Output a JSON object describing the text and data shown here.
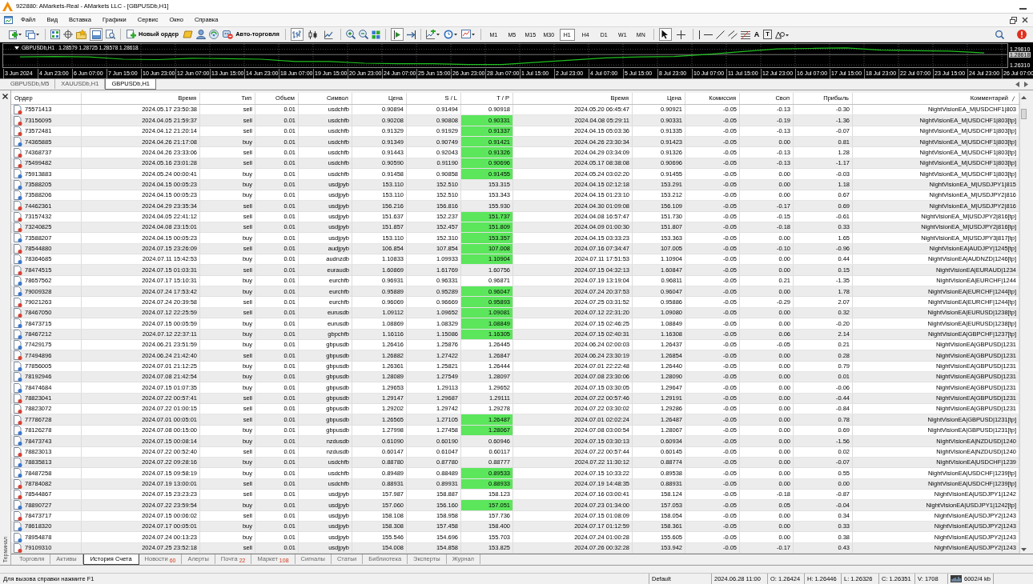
{
  "window": {
    "title": "922880: AMarkets-Real - AMarkets LLC - [GBPUSDb,H1]"
  },
  "menu": [
    "Файл",
    "Вид",
    "Вставка",
    "Графики",
    "Сервис",
    "Окно",
    "Справка"
  ],
  "toolbar": {
    "terminal_toggle": {
      "pressed": true
    },
    "new_order": "Новый ордер",
    "autotrading": "Авто-торговля",
    "chart_types": [
      {
        "selected": true
      },
      {
        "selected": false
      },
      {
        "selected": false
      }
    ],
    "chart_shift": {
      "pressed": true
    },
    "timeframes": [
      {
        "label": "M1",
        "selected": false
      },
      {
        "label": "M5",
        "selected": false
      },
      {
        "label": "M15",
        "selected": false
      },
      {
        "label": "M30",
        "selected": false
      },
      {
        "label": "H1",
        "selected": true
      },
      {
        "label": "H4",
        "selected": false
      },
      {
        "label": "D1",
        "selected": false
      },
      {
        "label": "W1",
        "selected": false
      },
      {
        "label": "MN",
        "selected": false
      }
    ],
    "cursor_tools": [
      {
        "selected": true
      },
      {
        "selected": false
      }
    ],
    "text_tools": [
      "A",
      "T"
    ]
  },
  "chart": {
    "symbol": "GBPUSDb,H1",
    "quotes": "1.28579 1.28725 1.28578 1.28618",
    "chart_data": [
      {
        "type": "line",
        "categories": [
          "3 Jun 2024",
          "4 Jun 23:00",
          "6 Jun 07:00",
          "7 Jun 15:00",
          "10 Jun 23:00",
          "12 Jun 07:00",
          "13 Jun 15:00",
          "14 Jun 23:00",
          "18 Jun 07:00",
          "19 Jun 15:00",
          "20 Jun 23:00",
          "24 Jun 07:00",
          "25 Jun 15:00",
          "26 Jun 23:00",
          "28 Jun 07:00",
          "1 Jul 15:00",
          "2 Jul 23:00",
          "4 Jul 07:00",
          "5 Jul 15:00",
          "8 Jul 23:00",
          "10 Jul 07:00",
          "11 Jul 15:00",
          "12 Jul 23:00",
          "16 Jul 07:00",
          "17 Jul 15:00",
          "18 Jul 23:00",
          "22 Jul 07:00",
          "23 Jul 15:00",
          "24 Jul 23:00",
          "26 Jul 07:00"
        ],
        "values": [
          1.281,
          1.282,
          1.281,
          1.276,
          1.275,
          1.278,
          1.277,
          1.276,
          1.271,
          1.271,
          1.267,
          1.266,
          1.266,
          1.264,
          1.264,
          1.269,
          1.274,
          1.279,
          1.281,
          1.282,
          1.287,
          1.293,
          1.299,
          1.3,
          1.301,
          1.296,
          1.295,
          1.294,
          1.29,
          null
        ],
        "color": "#1fc01f",
        "ylim": [
          1.2581,
          1.3098
        ],
        "yticks": [
          {
            "value": 1.2981,
            "label": "1.29810"
          },
          {
            "value": 1.2631,
            "label": "1.26310"
          }
        ],
        "ref_lines": [
          {
            "axis": "y",
            "value": 1.28618,
            "label": "1.28618",
            "color": "#c8c8c8",
            "line_style": "solid"
          }
        ],
        "grid": true
      }
    ]
  },
  "chart_tabs": [
    {
      "label": "GBPUSDb,M5",
      "selected": false
    },
    {
      "label": "XAUUSDb,H1",
      "selected": false
    },
    {
      "label": "GBPUSDb,H1",
      "selected": true
    }
  ],
  "terminal": {
    "side_label": "Терминал",
    "columns": [
      {
        "label": "Ордер",
        "sorted": false
      },
      {
        "label": "Время",
        "sorted": false
      },
      {
        "label": "Тип",
        "sorted": false
      },
      {
        "label": "Объем",
        "sorted": false
      },
      {
        "label": "Символ",
        "sorted": false
      },
      {
        "label": "Цена",
        "sorted": false
      },
      {
        "label": "S / L",
        "sorted": false
      },
      {
        "label": "T / P",
        "sorted": false
      },
      {
        "label": "Время",
        "sorted": false
      },
      {
        "label": "Цена",
        "sorted": false
      },
      {
        "label": "Комиссия",
        "sorted": false
      },
      {
        "label": "Своп",
        "sorted": false
      },
      {
        "label": "Прибыль",
        "sorted": false
      },
      {
        "label": "Комментарий",
        "sorted": true
      }
    ],
    "rows": [
      {
        "kind": "sell",
        "tp_hit": false,
        "cells": [
          "75571413",
          "2024.05.17 23:50:38",
          "sell",
          "0.01",
          "usdchfb",
          "0.90894",
          "0.91494",
          "0.90918",
          "2024.05.20 06:45:47",
          "0.90921",
          "-0.05",
          "-0.13",
          "-0.30",
          "NightVisionEA_M|USDCHF1|803"
        ]
      },
      {
        "kind": "sell",
        "tp_hit": true,
        "cells": [
          "73156095",
          "2024.04.05 21:59:37",
          "sell",
          "0.01",
          "usdchfb",
          "0.90208",
          "0.90808",
          "0.90331",
          "2024.04.08 05:29:11",
          "0.90331",
          "-0.05",
          "-0.19",
          "-1.36",
          "NightVisionEA_M|USDCHF1|803[tp]"
        ]
      },
      {
        "kind": "sell",
        "tp_hit": true,
        "cells": [
          "73572481",
          "2024.04.12 21:20:14",
          "sell",
          "0.01",
          "usdchfb",
          "0.91329",
          "0.91929",
          "0.91337",
          "2024.04.15 05:03:36",
          "0.91335",
          "-0.05",
          "-0.13",
          "-0.07",
          "NightVisionEA_M|USDCHF1|803[tp]"
        ]
      },
      {
        "kind": "buy",
        "tp_hit": true,
        "cells": [
          "74365885",
          "2024.04.26 21:17:08",
          "buy",
          "0.01",
          "usdchfb",
          "0.91349",
          "0.90749",
          "0.91421",
          "2024.04.26 23:30:34",
          "0.91423",
          "-0.05",
          "0.00",
          "0.81",
          "NightVisionEA_M|USDCHF1|803[tp]"
        ]
      },
      {
        "kind": "sell",
        "tp_hit": true,
        "cells": [
          "74368737",
          "2024.04.26 23:33:06",
          "sell",
          "0.01",
          "usdchfb",
          "0.91443",
          "0.92043",
          "0.91326",
          "2024.04.29 03:34:09",
          "0.91326",
          "-0.05",
          "-0.13",
          "1.28",
          "NightVisionEA_M|USDCHF1|803[tp]"
        ]
      },
      {
        "kind": "sell",
        "tp_hit": true,
        "cells": [
          "75499482",
          "2024.05.16 23:01:28",
          "sell",
          "0.01",
          "usdchfb",
          "0.90590",
          "0.91190",
          "0.90696",
          "2024.05.17 08:38:08",
          "0.90696",
          "-0.05",
          "-0.13",
          "-1.17",
          "NightVisionEA_M|USDCHF1|803[tp]"
        ]
      },
      {
        "kind": "buy",
        "tp_hit": true,
        "cells": [
          "75913883",
          "2024.05.24 00:00:41",
          "buy",
          "0.01",
          "usdchfb",
          "0.91458",
          "0.90858",
          "0.91455",
          "2024.05.24 03:02:20",
          "0.91455",
          "-0.05",
          "0.00",
          "-0.03",
          "NightVisionEA_M|USDCHF1|803[tp]"
        ]
      },
      {
        "kind": "buy",
        "tp_hit": false,
        "cells": [
          "73588205",
          "2024.04.15 00:05:23",
          "buy",
          "0.01",
          "usdjpyb",
          "153.110",
          "152.510",
          "153.315",
          "2024.04.15 02:12:18",
          "153.291",
          "-0.05",
          "0.00",
          "1.18",
          "NightVisionEA_M|USDJPY1|815"
        ]
      },
      {
        "kind": "buy",
        "tp_hit": false,
        "cells": [
          "73588206",
          "2024.04.15 00:05:23",
          "buy",
          "0.01",
          "usdjpyb",
          "153.110",
          "152.510",
          "153.343",
          "2024.04.15 01:23:10",
          "153.212",
          "-0.05",
          "0.00",
          "0.67",
          "NightVisionEA_M|USDJPY2|816"
        ]
      },
      {
        "kind": "sell",
        "tp_hit": false,
        "cells": [
          "74462361",
          "2024.04.29 23:35:34",
          "sell",
          "0.01",
          "usdjpyb",
          "156.216",
          "156.816",
          "155.930",
          "2024.04.30 01:09:08",
          "156.109",
          "-0.05",
          "-0.17",
          "0.69",
          "NightVisionEA_M|USDJPY2|816"
        ]
      },
      {
        "kind": "sell",
        "tp_hit": true,
        "cells": [
          "73157432",
          "2024.04.05 22:41:12",
          "sell",
          "0.01",
          "usdjpyb",
          "151.637",
          "152.237",
          "151.737",
          "2024.04.08 16:57:47",
          "151.730",
          "-0.05",
          "-0.15",
          "-0.61",
          "NightVisionEA_M|USDJPY2|816[tp]"
        ]
      },
      {
        "kind": "sell",
        "tp_hit": true,
        "cells": [
          "73240825",
          "2024.04.08 23:15:01",
          "sell",
          "0.01",
          "usdjpyb",
          "151.857",
          "152.457",
          "151.809",
          "2024.04.09 01:00:30",
          "151.807",
          "-0.05",
          "-0.18",
          "0.33",
          "NightVisionEA_M|USDJPY2|816[tp]"
        ]
      },
      {
        "kind": "buy",
        "tp_hit": true,
        "cells": [
          "73588207",
          "2024.04.15 00:05:23",
          "buy",
          "0.01",
          "usdjpyb",
          "153.110",
          "152.310",
          "153.357",
          "2024.04.15 03:33:23",
          "153.363",
          "-0.05",
          "0.00",
          "1.65",
          "NightVisionEA_M|USDJPY3|817[tp]"
        ]
      },
      {
        "kind": "sell",
        "tp_hit": true,
        "cells": [
          "78544880",
          "2024.07.15 23:26:09",
          "sell",
          "0.01",
          "audjpyb",
          "106.854",
          "107.854",
          "107.008",
          "2024.07.16 07:34:47",
          "107.005",
          "-0.05",
          "-0.10",
          "-0.96",
          "NightVisionEA|AUDJPY|1245[tp]"
        ]
      },
      {
        "kind": "buy",
        "tp_hit": true,
        "cells": [
          "78364685",
          "2024.07.11 15:42:53",
          "buy",
          "0.01",
          "audnzdb",
          "1.10833",
          "1.09933",
          "1.10904",
          "2024.07.11 17:51:53",
          "1.10904",
          "-0.05",
          "0.00",
          "0.44",
          "NightVisionEA|AUDNZD|1246[tp]"
        ]
      },
      {
        "kind": "sell",
        "tp_hit": false,
        "cells": [
          "78474515",
          "2024.07.15 01:03:31",
          "sell",
          "0.01",
          "euraudb",
          "1.60869",
          "1.61769",
          "1.60756",
          "2024.07.15 04:32:13",
          "1.60847",
          "-0.05",
          "0.00",
          "0.15",
          "NightVisionEA|EURAUD|1234"
        ]
      },
      {
        "kind": "buy",
        "tp_hit": false,
        "cells": [
          "78657562",
          "2024.07.17 15:10:31",
          "buy",
          "0.01",
          "eurchfb",
          "0.96931",
          "0.96331",
          "0.96871",
          "2024.07.19 13:19:04",
          "0.96811",
          "-0.05",
          "0.21",
          "-1.35",
          "NightVisionEA|EURCHF|1244"
        ]
      },
      {
        "kind": "buy",
        "tp_hit": true,
        "cells": [
          "79009328",
          "2024.07.24 17:53:42",
          "buy",
          "0.01",
          "eurchfb",
          "0.95889",
          "0.95289",
          "0.96047",
          "2024.07.24 20:37:53",
          "0.96047",
          "-0.05",
          "0.00",
          "1.78",
          "NightVisionEA|EURCHF|1244[tp]"
        ]
      },
      {
        "kind": "sell",
        "tp_hit": true,
        "cells": [
          "79021263",
          "2024.07.24 20:39:58",
          "sell",
          "0.01",
          "eurchfb",
          "0.96069",
          "0.96669",
          "0.95893",
          "2024.07.25 03:31:52",
          "0.95886",
          "-0.05",
          "-0.29",
          "2.07",
          "NightVisionEA|EURCHF|1244[tp]"
        ]
      },
      {
        "kind": "sell",
        "tp_hit": true,
        "cells": [
          "78467050",
          "2024.07.12 22:25:59",
          "sell",
          "0.01",
          "eurusdb",
          "1.09112",
          "1.09652",
          "1.09081",
          "2024.07.12 22:31:20",
          "1.09080",
          "-0.05",
          "0.00",
          "0.32",
          "NightVisionEA|EURUSD|1238[tp]"
        ]
      },
      {
        "kind": "buy",
        "tp_hit": true,
        "cells": [
          "78473715",
          "2024.07.15 00:05:59",
          "buy",
          "0.01",
          "eurusdb",
          "1.08869",
          "1.08329",
          "1.08849",
          "2024.07.15 02:46:25",
          "1.08849",
          "-0.05",
          "0.00",
          "-0.20",
          "NightVisionEA|EURUSD|1238[tp]"
        ]
      },
      {
        "kind": "buy",
        "tp_hit": true,
        "cells": [
          "78467212",
          "2024.07.12 22:37:11",
          "buy",
          "0.01",
          "gbpchfb",
          "1.16116",
          "1.15086",
          "1.16305",
          "2024.07.15 02:40:31",
          "1.16308",
          "-0.05",
          "0.06",
          "2.14",
          "NightVisionEA|GBPCHF|1237[tp]"
        ]
      },
      {
        "kind": "buy",
        "tp_hit": false,
        "cells": [
          "77429175",
          "2024.06.21 23:51:59",
          "buy",
          "0.01",
          "gbpusdb",
          "1.26416",
          "1.25876",
          "1.26445",
          "2024.06.24 02:00:03",
          "1.26437",
          "-0.05",
          "-0.05",
          "0.21",
          "NightVisionEA|GBPUSD|1231"
        ]
      },
      {
        "kind": "sell",
        "tp_hit": false,
        "cells": [
          "77494896",
          "2024.06.24 21:42:40",
          "sell",
          "0.01",
          "gbpusdb",
          "1.26882",
          "1.27422",
          "1.26847",
          "2024.06.24 23:30:19",
          "1.26854",
          "-0.05",
          "0.00",
          "0.28",
          "NightVisionEA|GBPUSD|1231"
        ]
      },
      {
        "kind": "buy",
        "tp_hit": false,
        "cells": [
          "77856005",
          "2024.07.01 21:12:25",
          "buy",
          "0.01",
          "gbpusdb",
          "1.26361",
          "1.25821",
          "1.26444",
          "2024.07.01 22:22:48",
          "1.26440",
          "-0.05",
          "0.00",
          "0.79",
          "NightVisionEA|GBPUSD|1231"
        ]
      },
      {
        "kind": "buy",
        "tp_hit": false,
        "cells": [
          "78192946",
          "2024.07.08 21:42:54",
          "buy",
          "0.01",
          "gbpusdb",
          "1.28089",
          "1.27549",
          "1.28097",
          "2024.07.08 23:30:06",
          "1.28090",
          "-0.05",
          "0.00",
          "0.01",
          "NightVisionEA|GBPUSD|1231"
        ]
      },
      {
        "kind": "buy",
        "tp_hit": false,
        "cells": [
          "78474684",
          "2024.07.15 01:07:35",
          "buy",
          "0.01",
          "gbpusdb",
          "1.29653",
          "1.29113",
          "1.29652",
          "2024.07.15 03:30:05",
          "1.29647",
          "-0.05",
          "0.00",
          "-0.06",
          "NightVisionEA|GBPUSD|1231"
        ]
      },
      {
        "kind": "sell",
        "tp_hit": false,
        "cells": [
          "78823041",
          "2024.07.22 00:57:41",
          "sell",
          "0.01",
          "gbpusdb",
          "1.29147",
          "1.29687",
          "1.29111",
          "2024.07.22 00:57:46",
          "1.29191",
          "-0.05",
          "0.00",
          "-0.44",
          "NightVisionEA|GBPUSD|1231"
        ]
      },
      {
        "kind": "sell",
        "tp_hit": false,
        "cells": [
          "78823072",
          "2024.07.22 01:00:15",
          "sell",
          "0.01",
          "gbpusdb",
          "1.29202",
          "1.29742",
          "1.29278",
          "2024.07.22 03:30:02",
          "1.29286",
          "-0.05",
          "0.00",
          "-0.84",
          "NightVisionEA|GBPUSD|1231"
        ]
      },
      {
        "kind": "sell",
        "tp_hit": true,
        "cells": [
          "77786728",
          "2024.07.01 00:05:01",
          "sell",
          "0.01",
          "gbpusdb",
          "1.26565",
          "1.27105",
          "1.26487",
          "2024.07.01 02:02:24",
          "1.26487",
          "-0.05",
          "0.00",
          "0.78",
          "NightVisionEA|GBPUSD|1231[tp]"
        ]
      },
      {
        "kind": "buy",
        "tp_hit": true,
        "cells": [
          "78126278",
          "2024.07.08 00:15:00",
          "buy",
          "0.01",
          "gbpusdb",
          "1.27998",
          "1.27458",
          "1.28067",
          "2024.07.08 03:00:54",
          "1.28067",
          "-0.05",
          "0.00",
          "0.69",
          "NightVisionEA|GBPUSD|1231[tp]"
        ]
      },
      {
        "kind": "buy",
        "tp_hit": false,
        "cells": [
          "78473743",
          "2024.07.15 00:08:14",
          "buy",
          "0.01",
          "nzdusdb",
          "0.61090",
          "0.60190",
          "0.60946",
          "2024.07.15 03:30:13",
          "0.60934",
          "-0.05",
          "0.00",
          "-1.56",
          "NightVisionEA|NZDUSD|1240"
        ]
      },
      {
        "kind": "sell",
        "tp_hit": false,
        "cells": [
          "78823013",
          "2024.07.22 00:52:40",
          "sell",
          "0.01",
          "nzdusdb",
          "0.60147",
          "0.61047",
          "0.60117",
          "2024.07.22 00:57:44",
          "0.60145",
          "-0.05",
          "0.00",
          "0.02",
          "NightVisionEA|NZDUSD|1240"
        ]
      },
      {
        "kind": "buy",
        "tp_hit": false,
        "cells": [
          "78835813",
          "2024.07.22 09:28:16",
          "buy",
          "0.01",
          "usdchfb",
          "0.88780",
          "0.87780",
          "0.88777",
          "2024.07.22 11:30:12",
          "0.88774",
          "-0.05",
          "0.00",
          "-0.07",
          "NightVisionEA|USDCHF|1239"
        ]
      },
      {
        "kind": "buy",
        "tp_hit": true,
        "cells": [
          "78487258",
          "2024.07.15 09:58:19",
          "buy",
          "0.01",
          "usdchfb",
          "0.89489",
          "0.88489",
          "0.89533",
          "2024.07.15 10:33:22",
          "0.89538",
          "-0.05",
          "0.00",
          "0.55",
          "NightVisionEA|USDCHF|1239[tp]"
        ]
      },
      {
        "kind": "sell",
        "tp_hit": true,
        "cells": [
          "78784082",
          "2024.07.19 13:00:01",
          "sell",
          "0.01",
          "usdchfb",
          "0.88931",
          "0.89931",
          "0.88933",
          "2024.07.19 14:48:35",
          "0.88931",
          "-0.05",
          "0.00",
          "0.00",
          "NightVisionEA|USDCHF|1239[tp]"
        ]
      },
      {
        "kind": "sell",
        "tp_hit": false,
        "cells": [
          "78544867",
          "2024.07.15 23:23:23",
          "sell",
          "0.01",
          "usdjpyb",
          "157.987",
          "158.887",
          "158.123",
          "2024.07.16 03:00:41",
          "158.124",
          "-0.05",
          "-0.18",
          "-0.87",
          "NightVisionEA|USDJPY1|1242"
        ]
      },
      {
        "kind": "buy",
        "tp_hit": true,
        "cells": [
          "78890727",
          "2024.07.22 23:59:54",
          "buy",
          "0.01",
          "usdjpyb",
          "157.060",
          "156.160",
          "157.051",
          "2024.07.23 01:34:00",
          "157.053",
          "-0.05",
          "0.05",
          "-0.04",
          "NightVisionEA|USDJPY1|1242[tp]"
        ]
      },
      {
        "kind": "sell",
        "tp_hit": false,
        "cells": [
          "78473717",
          "2024.07.15 00:06:02",
          "sell",
          "0.01",
          "usdjpyb",
          "158.108",
          "158.958",
          "157.736",
          "2024.07.15 01:08:09",
          "158.054",
          "-0.05",
          "0.00",
          "0.34",
          "NightVisionEA|USDJPY2|1243"
        ]
      },
      {
        "kind": "buy",
        "tp_hit": false,
        "cells": [
          "78618320",
          "2024.07.17 00:05:01",
          "buy",
          "0.01",
          "usdjpyb",
          "158.308",
          "157.458",
          "158.400",
          "2024.07.17 01:12:59",
          "158.361",
          "-0.05",
          "0.00",
          "0.33",
          "NightVisionEA|USDJPY2|1243"
        ]
      },
      {
        "kind": "buy",
        "tp_hit": false,
        "cells": [
          "78954878",
          "2024.07.24 00:13:23",
          "buy",
          "0.01",
          "usdjpyb",
          "155.546",
          "154.696",
          "155.703",
          "2024.07.24 01:00:28",
          "155.605",
          "-0.05",
          "0.00",
          "0.38",
          "NightVisionEA|USDJPY2|1243"
        ]
      },
      {
        "kind": "sell",
        "tp_hit": false,
        "cells": [
          "79109310",
          "2024.07.25 23:52:18",
          "sell",
          "0.01",
          "usdjpyb",
          "154.008",
          "154.858",
          "153.825",
          "2024.07.26 00:32:28",
          "153.942",
          "-0.05",
          "-0.17",
          "0.43",
          "NightVisionEA|USDJPY2|1243"
        ]
      }
    ],
    "tabs": [
      {
        "label": "Торговля",
        "selected": false
      },
      {
        "label": "Активы",
        "selected": false
      },
      {
        "label": "История Счета",
        "selected": true
      },
      {
        "label": "Новости",
        "count": "60",
        "selected": false
      },
      {
        "label": "Алерты",
        "selected": false
      },
      {
        "label": "Почта",
        "count": "22",
        "selected": false
      },
      {
        "label": "Маркет",
        "count": "108",
        "selected": false
      },
      {
        "label": "Сигналы",
        "selected": false
      },
      {
        "label": "Статьи",
        "selected": false
      },
      {
        "label": "Библиотека",
        "selected": false
      },
      {
        "label": "Эксперты",
        "selected": false
      },
      {
        "label": "Журнал",
        "selected": false
      }
    ]
  },
  "status_bar": {
    "help": "Для вызова справки нажмите F1",
    "fields": [
      "Default",
      "2024.06.28 11:00",
      "O: 1.26424",
      "H: 1.26446",
      "L: 1.26326",
      "C: 1.26351",
      "V: 1708"
    ],
    "traffic": "6002/4 kb"
  }
}
